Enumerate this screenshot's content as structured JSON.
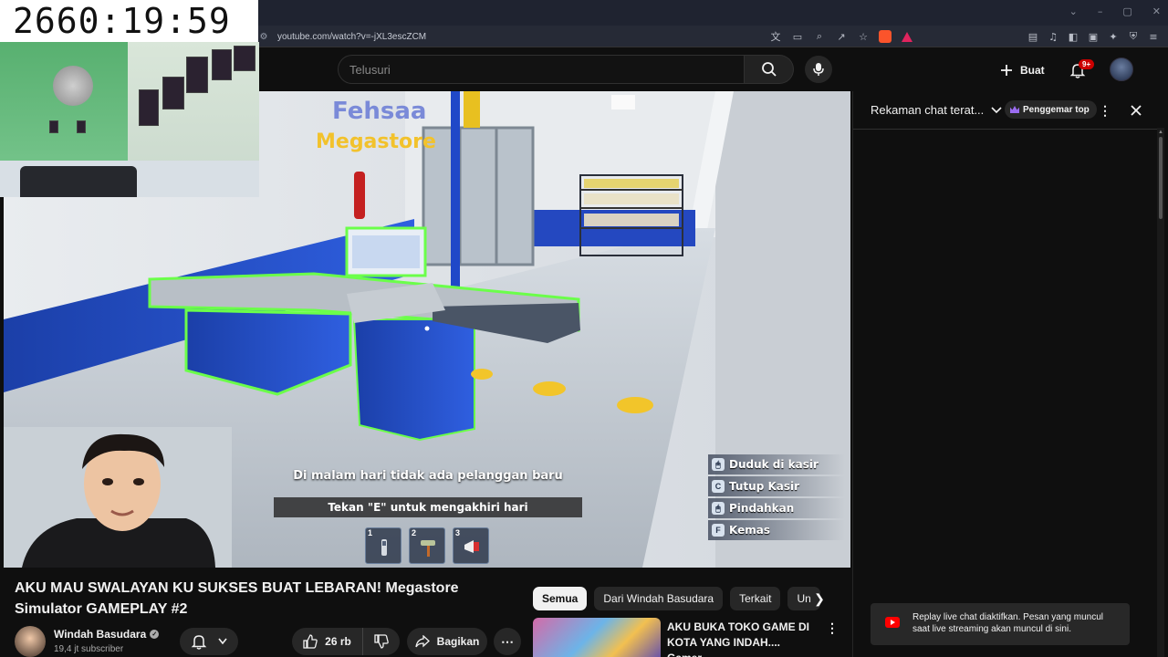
{
  "timer": "2660:19:59",
  "browser": {
    "url": "youtube.com/watch?v=-jXL3escZCM",
    "window_controls": [
      "⌄",
      "–",
      "▢",
      "✕"
    ]
  },
  "header": {
    "search_placeholder": "Telusuri",
    "create_label": "Buat",
    "notification_count": "9+"
  },
  "game": {
    "subtitle_1": "Di malam hari tidak ada pelanggan baru",
    "subtitle_2": "Tekan \"E\" untuk mengakhiri hari",
    "store_sign_1": "Fehsaa",
    "store_sign_2": "Megastore",
    "hotbar": [
      {
        "num": "1",
        "item": "scanner"
      },
      {
        "num": "2",
        "item": "roller"
      },
      {
        "num": "3",
        "item": "megaphone"
      }
    ],
    "key_hints": [
      {
        "key": "🖱",
        "label": "Duduk di kasir"
      },
      {
        "key": "C",
        "label": "Tutup Kasir"
      },
      {
        "key": "🖱",
        "label": "Pindahkan"
      },
      {
        "key": "F",
        "label": "Kemas"
      }
    ]
  },
  "video": {
    "title": "AKU MAU SWALAYAN KU SUKSES BUAT LEBARAN! Megastore Simulator GAMEPLAY #2",
    "channel": "Windah Basudara",
    "subscribers": "19,4 jt subscriber",
    "likes": "26 rb",
    "share_label": "Bagikan"
  },
  "related": {
    "chips": [
      "Semua",
      "Dari Windah Basudara",
      "Terkait",
      "Un"
    ],
    "active_chip": "Semua",
    "first_video_title": "AKU BUKA TOKO GAME DI KOTA YANG INDAH.... Gamer ..."
  },
  "chat": {
    "title": "Rekaman chat terat...",
    "top_fan_label": "Penggemar top",
    "toast": "Replay live chat diaktifkan. Pesan yang muncul saat live streaming akan muncul di sini."
  },
  "colors": {
    "accent_red": "#ff0000",
    "counter_blue": "#1e4fc4",
    "highlight_green": "#6bff4a"
  }
}
